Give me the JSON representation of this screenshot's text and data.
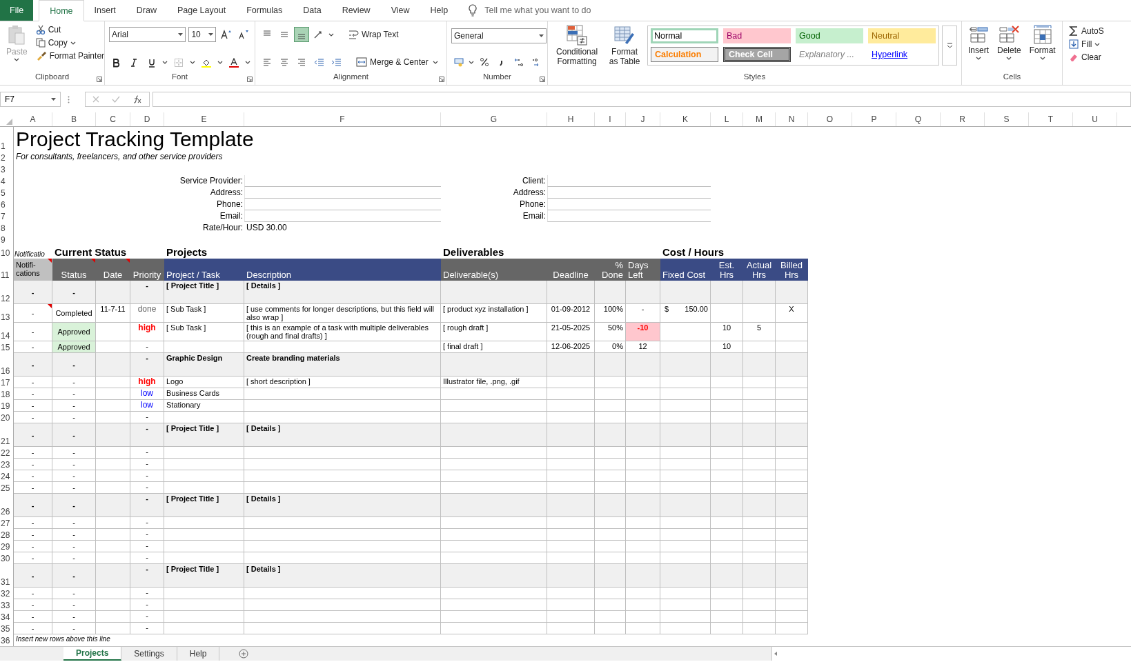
{
  "ribbon": {
    "tabs": [
      {
        "label": "File",
        "kind": "file",
        "selected": false
      },
      {
        "label": "Home",
        "kind": "tab",
        "selected": true
      },
      {
        "label": "Insert",
        "kind": "tab",
        "selected": false
      },
      {
        "label": "Draw",
        "kind": "tab",
        "selected": false
      },
      {
        "label": "Page Layout",
        "kind": "tab",
        "selected": false
      },
      {
        "label": "Formulas",
        "kind": "tab",
        "selected": false
      },
      {
        "label": "Data",
        "kind": "tab",
        "selected": false
      },
      {
        "label": "Review",
        "kind": "tab",
        "selected": false
      },
      {
        "label": "View",
        "kind": "tab",
        "selected": false
      },
      {
        "label": "Help",
        "kind": "tab",
        "selected": false
      }
    ],
    "tell_me": {
      "placeholder": "Tell me what you want to do"
    },
    "clipboard": {
      "paste": {
        "label": "Paste",
        "disabled": true
      },
      "cut": "Cut",
      "copy": "Copy",
      "format_painter": "Format Painter",
      "label": "Clipboard"
    },
    "font": {
      "name": "Arial",
      "size": "10",
      "label": "Font"
    },
    "alignment": {
      "vertical": [
        {
          "kind": "top",
          "selected": false
        },
        {
          "kind": "middle",
          "selected": false
        },
        {
          "kind": "bottom",
          "selected": true
        }
      ],
      "wrap_text": "Wrap Text",
      "merge": "Merge & Center",
      "label": "Alignment"
    },
    "number": {
      "format": "General",
      "label": "Number"
    },
    "styles": {
      "conditional": "Conditional Formatting",
      "format_table": "Format as Table",
      "gallery": [
        {
          "label": "Normal",
          "kind": "normal",
          "selected": true
        },
        {
          "label": "Bad",
          "kind": "bad",
          "selected": false
        },
        {
          "label": "Good",
          "kind": "good",
          "selected": false
        },
        {
          "label": "Neutral",
          "kind": "neutral",
          "selected": false
        },
        {
          "label": "Calculation",
          "kind": "calculation",
          "selected": false
        },
        {
          "label": "Check Cell",
          "kind": "check",
          "selected": false
        },
        {
          "label": "Explanatory ...",
          "kind": "explanatory",
          "selected": false
        },
        {
          "label": "Hyperlink",
          "kind": "hyperlink",
          "selected": false
        }
      ],
      "label": "Styles"
    },
    "cells": {
      "buttons": [
        {
          "label": "Insert",
          "kind": "insert"
        },
        {
          "label": "Delete",
          "kind": "delete"
        },
        {
          "label": "Format",
          "kind": "format"
        }
      ],
      "label": "Cells"
    },
    "editing": {
      "buttons": [
        {
          "label": "AutoS",
          "kind": "sum"
        },
        {
          "label": "Fill",
          "kind": "fill"
        },
        {
          "label": "Clear",
          "kind": "clear"
        }
      ]
    }
  },
  "formula_bar": {
    "name_box": "F7"
  },
  "column_headers": [
    "A",
    "B",
    "C",
    "D",
    "E",
    "F",
    "G",
    "H",
    "I",
    "J",
    "K",
    "L",
    "M",
    "N",
    "O",
    "P",
    "Q",
    "R",
    "S",
    "T",
    "U"
  ],
  "sheet": {
    "rows": [
      {
        "number": "1",
        "kind": "title",
        "text": "Project Tracking Template"
      },
      {
        "number": "2",
        "kind": "subtitle",
        "text": "For consultants, freelancers, and other service providers"
      },
      {
        "number": "3",
        "kind": "blank"
      },
      {
        "number": "4",
        "kind": "info",
        "provider_label": "Service Provider:",
        "client_label": "Client:"
      },
      {
        "number": "5",
        "kind": "info",
        "provider_label": "Address:",
        "client_label": "Address:"
      },
      {
        "number": "6",
        "kind": "info",
        "provider_label": "Phone:",
        "client_label": "Phone:"
      },
      {
        "number": "7",
        "kind": "info",
        "provider_label": "Email:",
        "client_label": "Email:"
      },
      {
        "number": "8",
        "kind": "info",
        "provider_label": "Rate/Hour:",
        "provider_value": "USD 30.00"
      },
      {
        "number": "9",
        "kind": "blank"
      },
      {
        "number": "10",
        "kind": "sections",
        "notification": "Notificatio",
        "status": "Current Status",
        "projects": "Projects",
        "deliverables": "Deliverables",
        "cost": "Cost / Hours"
      },
      {
        "number": "11",
        "kind": "header",
        "cells": [
          {
            "label": "Notifi-cations",
            "kind": "light",
            "comment": true
          },
          {
            "label": "Status",
            "kind": "dark",
            "comment": true
          },
          {
            "label": "Date",
            "kind": "dark",
            "comment": true
          },
          {
            "label": "Priority",
            "kind": "dark",
            "comment": false
          },
          {
            "label": "Project / Task",
            "kind": "blue",
            "comment": false
          },
          {
            "label": "Description",
            "kind": "blue",
            "comment": false
          },
          {
            "label": "Deliverable(s)",
            "kind": "dark",
            "comment": false
          },
          {
            "label": "Deadline",
            "kind": "dark",
            "comment": false
          },
          {
            "label": "% Done",
            "kind": "dark",
            "comment": false
          },
          {
            "label": "Days Left",
            "kind": "dark",
            "comment": false
          },
          {
            "label": "Fixed Cost",
            "kind": "blue",
            "comment": false
          },
          {
            "label": "Est. Hrs",
            "kind": "blue",
            "comment": false
          },
          {
            "label": "Actual Hrs",
            "kind": "blue",
            "comment": false
          },
          {
            "label": "Billed Hrs",
            "kind": "blue",
            "comment": false
          }
        ]
      },
      {
        "number": "12",
        "kind": "project",
        "note": "-",
        "status": "-",
        "priority": {
          "text": "-",
          "kind": "none"
        },
        "task": "[ Project Title ]",
        "description": "[ Details ]"
      },
      {
        "number": "13",
        "kind": "task",
        "note": "-",
        "comment": true,
        "status": "Completed",
        "status_highlight": false,
        "date": "11-7-11",
        "priority": {
          "text": "done",
          "kind": "done"
        },
        "task": "[ Sub Task ]",
        "description": "[ use comments for longer descriptions, but this field will also wrap ]",
        "deliverable": "[ product xyz installation ]",
        "deadline": "01-09-2012",
        "done": "100%",
        "days_left": "-",
        "overdue": false,
        "fixed_cost_symbol": "$",
        "fixed_cost": "150.00",
        "billed_hrs": "X"
      },
      {
        "number": "14",
        "kind": "task",
        "note": "-",
        "comment": false,
        "status": "Approved",
        "status_highlight": true,
        "priority": {
          "text": "high",
          "kind": "high"
        },
        "task": "[ Sub Task ]",
        "description": "[ this is an example of a task with multiple deliverables (rough and final drafts) ]",
        "deliverable": "[ rough draft ]",
        "deadline": "21-05-2025",
        "done": "50%",
        "days_left": "-10",
        "overdue": true,
        "est_hrs": "10",
        "actual_hrs": "5"
      },
      {
        "number": "15",
        "kind": "task",
        "note": "-",
        "comment": false,
        "status": "Approved",
        "status_highlight": true,
        "priority": {
          "text": "-",
          "kind": "none"
        },
        "deliverable": "[ final draft ]",
        "deadline": "12-06-2025",
        "done": "0%",
        "days_left": "12",
        "overdue": false,
        "est_hrs": "10"
      },
      {
        "number": "16",
        "kind": "project",
        "note": "-",
        "status": "-",
        "priority": {
          "text": "-",
          "kind": "none"
        },
        "task": "Graphic Design",
        "description": "Create branding materials"
      },
      {
        "number": "17",
        "kind": "task",
        "note": "-",
        "comment": false,
        "status": "-",
        "status_highlight": false,
        "priority": {
          "text": "high",
          "kind": "high"
        },
        "task": "Logo",
        "description": "[ short description ]",
        "deliverable": "Illustrator file, .png, .gif"
      },
      {
        "number": "18",
        "kind": "task",
        "note": "-",
        "comment": false,
        "status": "-",
        "status_highlight": false,
        "priority": {
          "text": "low",
          "kind": "low"
        },
        "task": "Business Cards"
      },
      {
        "number": "19",
        "kind": "task",
        "note": "-",
        "comment": false,
        "status": "-",
        "status_highlight": false,
        "priority": {
          "text": "low",
          "kind": "low"
        },
        "task": "Stationary"
      },
      {
        "number": "20",
        "kind": "task",
        "note": "-",
        "comment": false,
        "status": "-",
        "status_highlight": false,
        "priority": {
          "text": "-",
          "kind": "none"
        }
      },
      {
        "number": "21",
        "kind": "project",
        "note": "-",
        "status": "-",
        "priority": {
          "text": "-",
          "kind": "none"
        },
        "task": "[ Project Title ]",
        "description": "[ Details ]"
      },
      {
        "number": "22",
        "kind": "task",
        "note": "-",
        "comment": false,
        "status": "-",
        "status_highlight": false,
        "priority": {
          "text": "-",
          "kind": "none"
        }
      },
      {
        "number": "23",
        "kind": "task",
        "note": "-",
        "comment": false,
        "status": "-",
        "status_highlight": false,
        "priority": {
          "text": "-",
          "kind": "none"
        }
      },
      {
        "number": "24",
        "kind": "task",
        "note": "-",
        "comment": false,
        "status": "-",
        "status_highlight": false,
        "priority": {
          "text": "-",
          "kind": "none"
        }
      },
      {
        "number": "25",
        "kind": "task",
        "note": "-",
        "comment": false,
        "status": "-",
        "status_highlight": false,
        "priority": {
          "text": "-",
          "kind": "none"
        }
      },
      {
        "number": "26",
        "kind": "project",
        "note": "-",
        "status": "-",
        "priority": {
          "text": "-",
          "kind": "none"
        },
        "task": "[ Project Title ]",
        "description": "[ Details ]"
      },
      {
        "number": "27",
        "kind": "task",
        "note": "-",
        "comment": false,
        "status": "-",
        "status_highlight": false,
        "priority": {
          "text": "-",
          "kind": "none"
        }
      },
      {
        "number": "28",
        "kind": "task",
        "note": "-",
        "comment": false,
        "status": "-",
        "status_highlight": false,
        "priority": {
          "text": "-",
          "kind": "none"
        }
      },
      {
        "number": "29",
        "kind": "task",
        "note": "-",
        "comment": false,
        "status": "-",
        "status_highlight": false,
        "priority": {
          "text": "-",
          "kind": "none"
        }
      },
      {
        "number": "30",
        "kind": "task",
        "note": "-",
        "comment": false,
        "status": "-",
        "status_highlight": false,
        "priority": {
          "text": "-",
          "kind": "none"
        }
      },
      {
        "number": "31",
        "kind": "project",
        "note": "-",
        "status": "-",
        "priority": {
          "text": "-",
          "kind": "none"
        },
        "task": "[ Project Title ]",
        "description": "[ Details ]"
      },
      {
        "number": "32",
        "kind": "task",
        "note": "-",
        "comment": false,
        "status": "-",
        "status_highlight": false,
        "priority": {
          "text": "-",
          "kind": "none"
        }
      },
      {
        "number": "33",
        "kind": "task",
        "note": "-",
        "comment": false,
        "status": "-",
        "status_highlight": false,
        "priority": {
          "text": "-",
          "kind": "none"
        }
      },
      {
        "number": "34",
        "kind": "task",
        "note": "-",
        "comment": false,
        "status": "-",
        "status_highlight": false,
        "priority": {
          "text": "-",
          "kind": "none"
        }
      },
      {
        "number": "35",
        "kind": "task",
        "note": "-",
        "comment": false,
        "status": "-",
        "status_highlight": false,
        "priority": {
          "text": "-",
          "kind": "none"
        }
      },
      {
        "number": "36",
        "kind": "note",
        "text": "Insert new rows above this line"
      }
    ]
  },
  "sheet_tabs": [
    {
      "label": "Projects",
      "selected": true
    },
    {
      "label": "Settings",
      "selected": false
    },
    {
      "label": "Help",
      "selected": false
    }
  ]
}
